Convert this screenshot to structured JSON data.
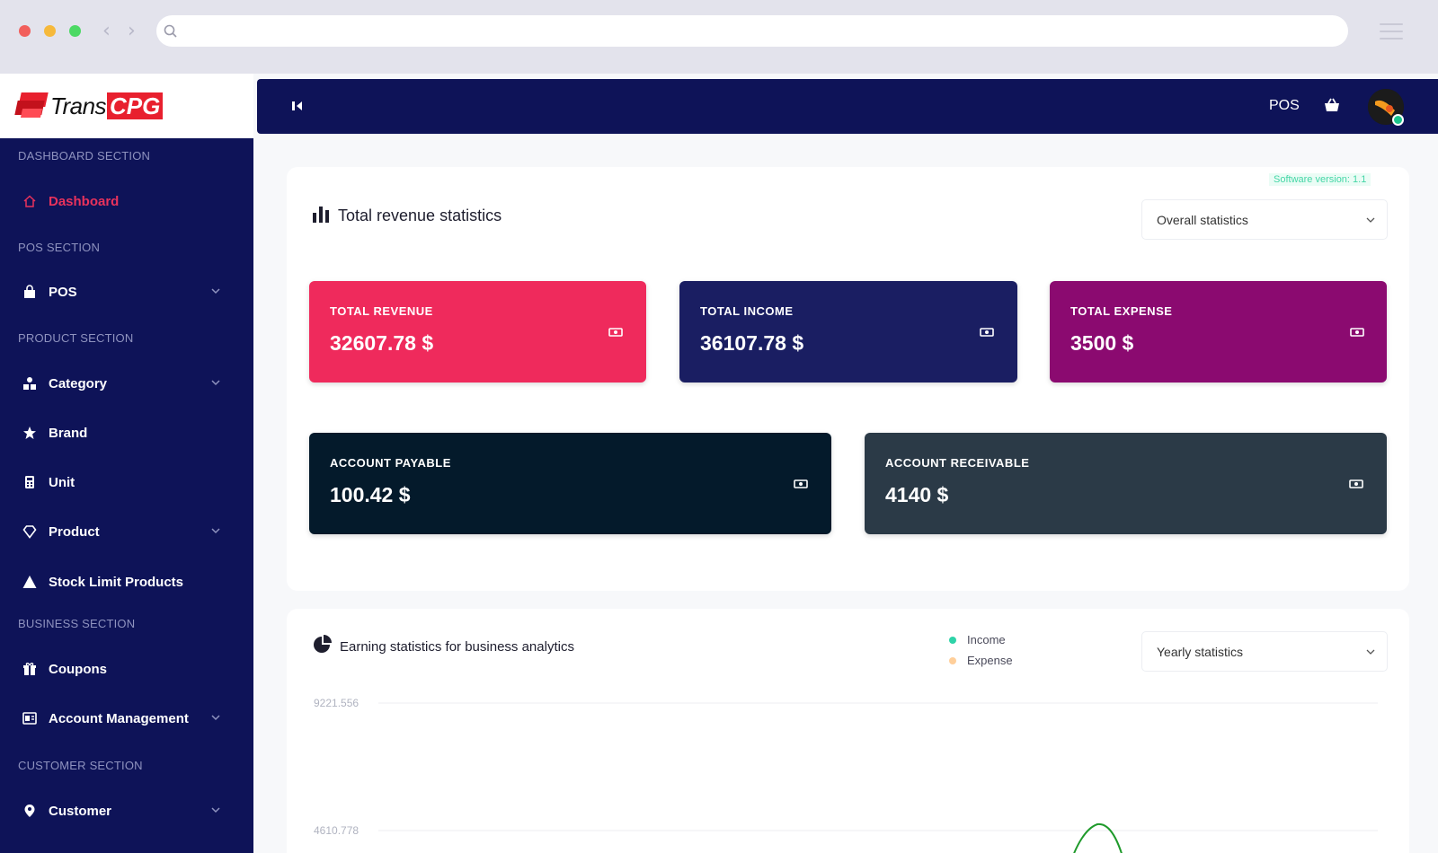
{
  "sidebar": {
    "logo": {
      "text_a": "Trans",
      "text_b": "CPG"
    },
    "sections": [
      {
        "label": "DASHBOARD SECTION"
      },
      {
        "label": "POS SECTION"
      },
      {
        "label": "PRODUCT SECTION"
      },
      {
        "label": "BUSINESS SECTION"
      },
      {
        "label": "CUSTOMER SECTION"
      }
    ],
    "items": [
      {
        "label": "Dashboard",
        "icon": "home-icon",
        "active": true
      },
      {
        "label": "POS",
        "icon": "shopping-bag-icon",
        "expandable": true
      },
      {
        "label": "Category",
        "icon": "category-icon",
        "expandable": true
      },
      {
        "label": "Brand",
        "icon": "star-icon"
      },
      {
        "label": "Unit",
        "icon": "unit-icon"
      },
      {
        "label": "Product",
        "icon": "diamond-icon",
        "expandable": true
      },
      {
        "label": "Stock Limit Products",
        "icon": "warning-icon"
      },
      {
        "label": "Coupons",
        "icon": "gift-icon"
      },
      {
        "label": "Account Management",
        "icon": "account-icon",
        "expandable": true
      },
      {
        "label": "Customer",
        "icon": "customer-icon",
        "expandable": true
      }
    ]
  },
  "header": {
    "collapse_icon": "collapse-icon",
    "pos_label": "POS",
    "basket_icon": "basket-icon"
  },
  "revenue": {
    "version": "Software version: 1.1",
    "title": "Total revenue statistics",
    "select_value": "Overall statistics",
    "cards": [
      {
        "label": "TOTAL REVENUE",
        "value": "32607.78 $",
        "color": "#ef2a5c"
      },
      {
        "label": "TOTAL INCOME",
        "value": "36107.78 $",
        "color": "#1a1e62"
      },
      {
        "label": "TOTAL EXPENSE",
        "value": "3500 $",
        "color": "#8b0a70"
      },
      {
        "label": "ACCOUNT PAYABLE",
        "value": "100.42 $",
        "color": "#041a2b"
      },
      {
        "label": "ACCOUNT RECEIVABLE",
        "value": "4140 $",
        "color": "#2b3a47"
      }
    ]
  },
  "earnings": {
    "title": "Earning statistics for business analytics",
    "select_value": "Yearly statistics",
    "legend": [
      {
        "label": "Income",
        "color": "#2ed3a8"
      },
      {
        "label": "Expense",
        "color": "#ffcf9a"
      }
    ],
    "chart_data": {
      "type": "line",
      "series": [
        {
          "name": "Income"
        },
        {
          "name": "Expense"
        }
      ],
      "ytick_labels": [
        "9221.556",
        "4610.778"
      ]
    }
  },
  "colors": {
    "sidebar_bg": "#0e1358",
    "accent": "#ef2a5c",
    "income_line": "#1f9a2b"
  }
}
